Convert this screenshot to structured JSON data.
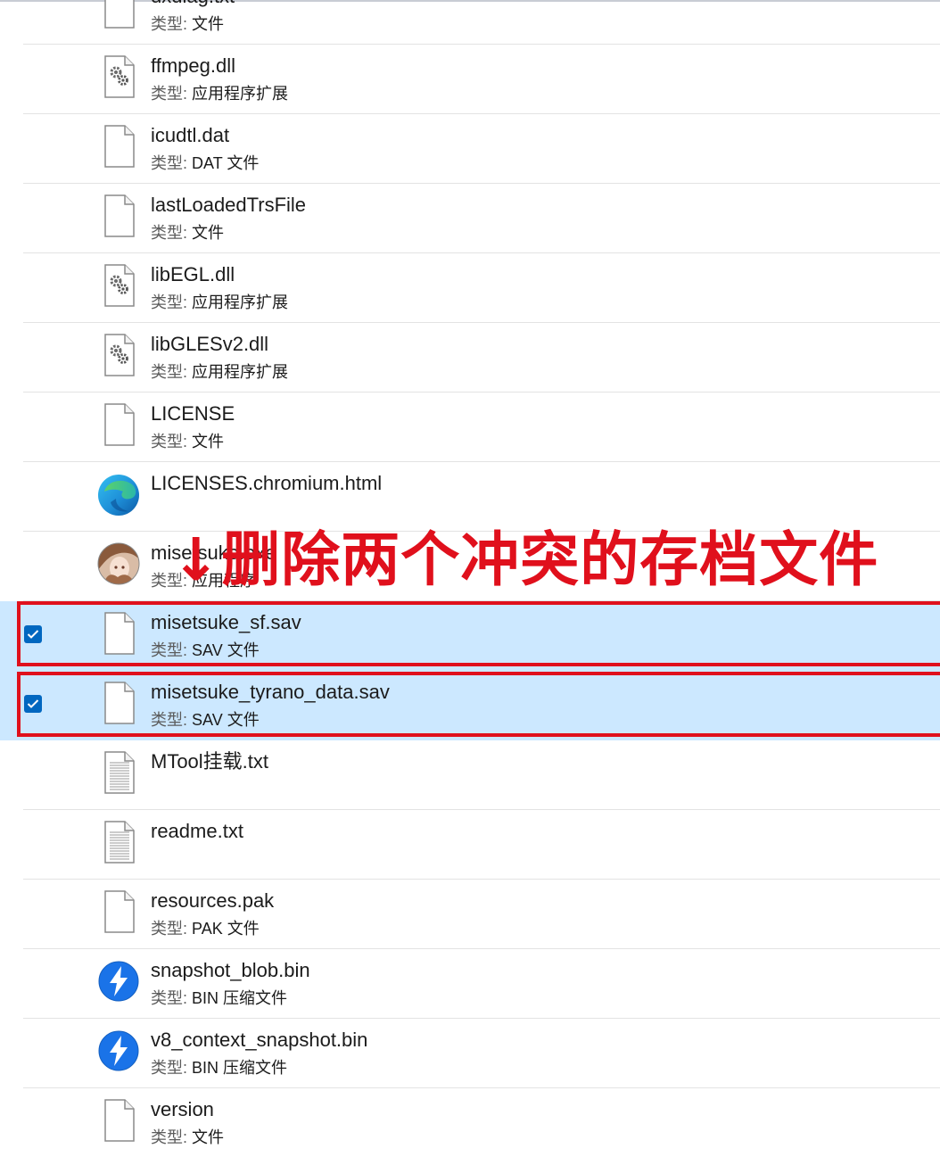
{
  "type_prefix": "类型:",
  "files": [
    {
      "name": "dxdiag.txt",
      "type": "文件",
      "icon": "blank-file-icon"
    },
    {
      "name": "ffmpeg.dll",
      "type": "应用程序扩展",
      "icon": "dll-gear-icon"
    },
    {
      "name": "icudtl.dat",
      "type": "DAT 文件",
      "icon": "blank-file-icon"
    },
    {
      "name": "lastLoadedTrsFile",
      "type": "文件",
      "icon": "blank-file-icon"
    },
    {
      "name": "libEGL.dll",
      "type": "应用程序扩展",
      "icon": "dll-gear-icon"
    },
    {
      "name": "libGLESv2.dll",
      "type": "应用程序扩展",
      "icon": "dll-gear-icon"
    },
    {
      "name": "LICENSE",
      "type": "文件",
      "icon": "blank-file-icon"
    },
    {
      "name": "LICENSES.chromium.html",
      "type": "",
      "icon": "edge-browser-icon"
    },
    {
      "name": "misetsuke.exe",
      "type": "应用程序",
      "icon": "app-avatar-icon"
    },
    {
      "name": "misetsuke_sf.sav",
      "type": "SAV 文件",
      "icon": "blank-file-icon",
      "selected": true
    },
    {
      "name": "misetsuke_tyrano_data.sav",
      "type": "SAV 文件",
      "icon": "blank-file-icon",
      "selected": true
    },
    {
      "name": "MTool挂载.txt",
      "type": "",
      "icon": "text-file-icon"
    },
    {
      "name": "readme.txt",
      "type": "",
      "icon": "text-file-icon"
    },
    {
      "name": "resources.pak",
      "type": "PAK 文件",
      "icon": "blank-file-icon"
    },
    {
      "name": "snapshot_blob.bin",
      "type": "BIN 压缩文件",
      "icon": "bandizip-archive-icon"
    },
    {
      "name": "v8_context_snapshot.bin",
      "type": "BIN 压缩文件",
      "icon": "bandizip-archive-icon"
    },
    {
      "name": "version",
      "type": "文件",
      "icon": "blank-file-icon"
    }
  ],
  "annotation": {
    "text": "↓删除两个冲突的存档文件",
    "color": "#e0101c"
  },
  "colors": {
    "selection": "#cce8ff",
    "checkbox": "#0067c0",
    "annotation": "#e0101c"
  }
}
